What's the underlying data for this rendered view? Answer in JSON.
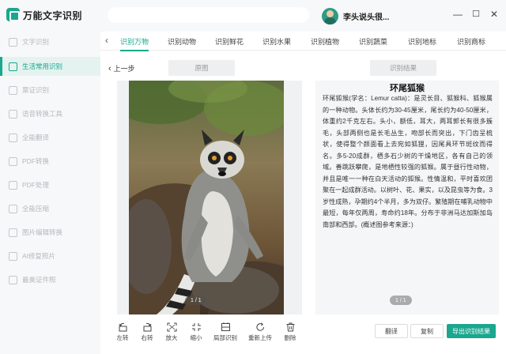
{
  "app": {
    "title": "万能文字识别"
  },
  "user": {
    "name": "李头说头很..."
  },
  "window_controls": {
    "minimize": "—",
    "maximize": "☐",
    "close": "✕"
  },
  "sidebar": {
    "items": [
      {
        "label": "文字识别",
        "active": false
      },
      {
        "label": "生活常用识别",
        "active": true
      },
      {
        "label": "票证识别",
        "active": false
      },
      {
        "label": "语音转换工具",
        "active": false
      },
      {
        "label": "全能翻译",
        "active": false
      },
      {
        "label": "PDF转换",
        "active": false
      },
      {
        "label": "PDF处理",
        "active": false
      },
      {
        "label": "全能压缩",
        "active": false
      },
      {
        "label": "图片编辑转换",
        "active": false
      },
      {
        "label": "AI修复照片",
        "active": false
      },
      {
        "label": "最美证件照",
        "active": false
      }
    ]
  },
  "tabs": [
    "识别万物",
    "识别动物",
    "识别鲜花",
    "识别水果",
    "识别植物",
    "识别蔬菜",
    "识别地标",
    "识别商标"
  ],
  "toolbar": {
    "back": "上一步",
    "original_label": "原图",
    "result_label": "识别结果"
  },
  "image_panel": {
    "page": "1 / 1"
  },
  "result": {
    "title": "环尾狐猴",
    "text": "环尾狐猴(学名：Lemur catta)：是灵长目、狐猴科、狐猴属的一种动物。头体长约为30-45厘米，尾长约为40-50厘米，体重约2千克左右。头小，额低，耳大，两耳郭长有很多簇毛，头部两侧也是长毛丛生，吻部长而突出，下门齿呈梳状，使得整个颜面看上去宛如狐狸，因尾具环节斑纹而得名。多5-20成群，栖多石少树的干燥地区，各有自己的领域。善跳跃攀爬，是地栖性较强的狐猴。属于昼行性动物，并且是唯一一种在白天活动的狐猴。性情温和，平时喜欢团聚在一起成群活动。以树叶、花、果实，以及昆虫等为食。3岁性成熟，孕期约4个半月，多为双仔。繁殖期在哺乳动物中最短，每年仅两周，寿命约18年。分布于非洲马达加斯加岛南部和西部。(概述图参考来源：)",
    "page": "1 / 1"
  },
  "tools": [
    {
      "label": "左转",
      "icon": "rotate-left-icon"
    },
    {
      "label": "右转",
      "icon": "rotate-right-icon"
    },
    {
      "label": "放大",
      "icon": "zoom-in-icon"
    },
    {
      "label": "缩小",
      "icon": "zoom-out-icon"
    },
    {
      "label": "局部识别",
      "icon": "crop-icon"
    },
    {
      "label": "重新上传",
      "icon": "refresh-icon"
    },
    {
      "label": "删除",
      "icon": "trash-icon"
    }
  ],
  "actions": {
    "translate": "翻译",
    "copy": "复制",
    "export": "导出识别结果"
  },
  "colors": {
    "accent": "#1aa78d"
  }
}
